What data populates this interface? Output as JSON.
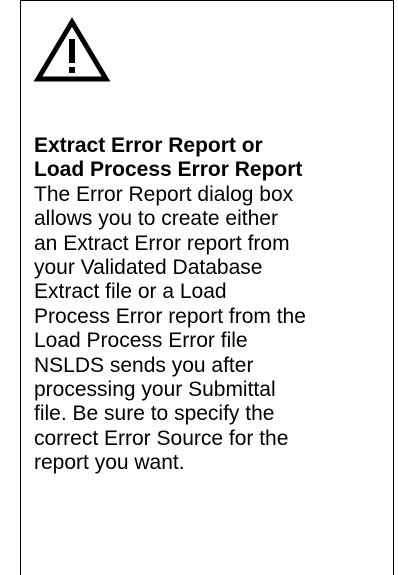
{
  "panel": {
    "icon": "warning-icon",
    "title_line1": "Extract Error Report or",
    "title_line2": "Load Process Error Report",
    "body_lines": [
      "The Error Report dialog box",
      "allows you to create either",
      "an Extract Error report from",
      "your Validated Database",
      "Extract file or a Load",
      "Process Error report from the",
      "Load Process Error file",
      "NSLDS sends you after",
      "processing your Submittal",
      "file. Be sure to specify the",
      "correct Error Source for the",
      "report you want."
    ]
  }
}
